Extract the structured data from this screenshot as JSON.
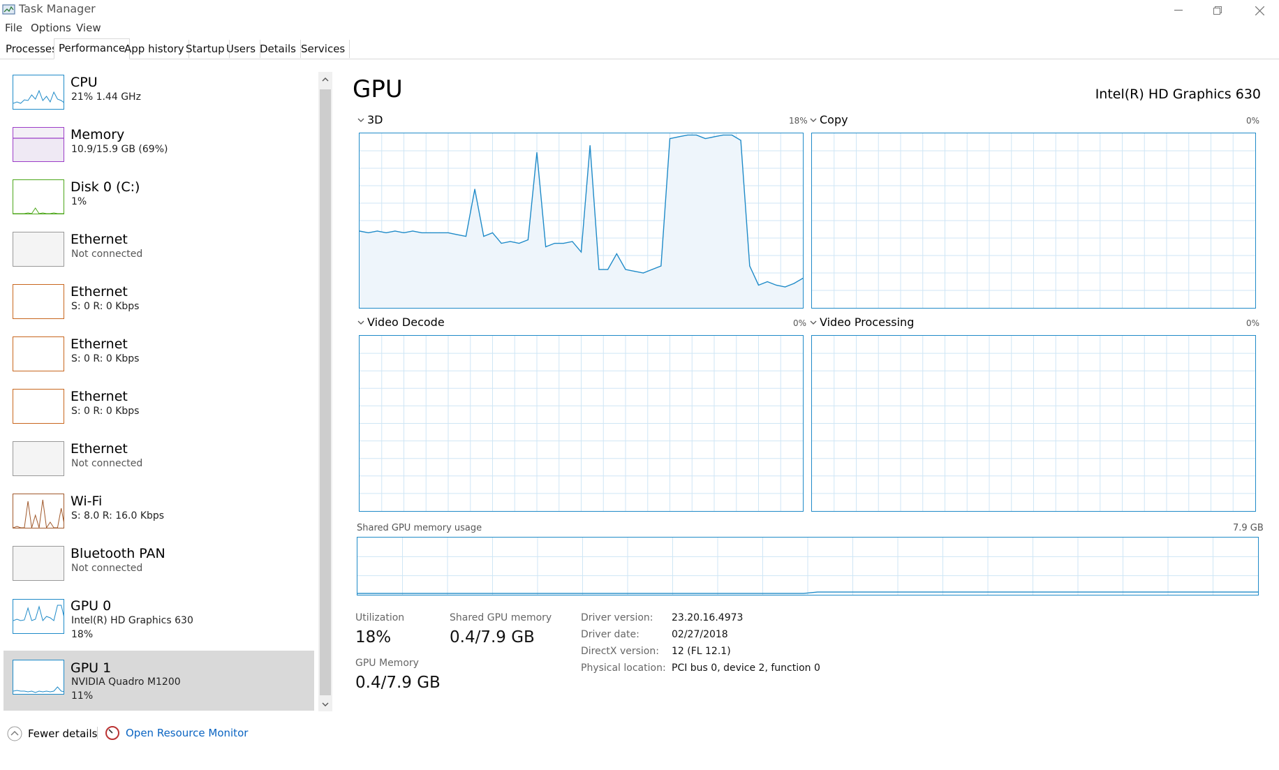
{
  "window": {
    "title": "Task Manager"
  },
  "menu": [
    "File",
    "Options",
    "View"
  ],
  "tabs": [
    "Processes",
    "Performance",
    "App history",
    "Startup",
    "Users",
    "Details",
    "Services"
  ],
  "active_tab": "Performance",
  "sidebar": {
    "items": [
      {
        "name": "CPU",
        "sub": "21%  1.44 GHz",
        "color": "#1e8ac8"
      },
      {
        "name": "Memory",
        "sub": "10.9/15.9 GB (69%)",
        "color": "#9c3dc8"
      },
      {
        "name": "Disk 0 (C:)",
        "sub": "1%",
        "color": "#4ca619"
      },
      {
        "name": "Ethernet",
        "sub": "Not connected",
        "color": "#999999"
      },
      {
        "name": "Ethernet",
        "sub": "S: 0  R: 0 Kbps",
        "color": "#c8661e"
      },
      {
        "name": "Ethernet",
        "sub": "S: 0  R: 0 Kbps",
        "color": "#c8661e"
      },
      {
        "name": "Ethernet",
        "sub": "S: 0  R: 0 Kbps",
        "color": "#c8661e"
      },
      {
        "name": "Ethernet",
        "sub": "Not connected",
        "color": "#999999"
      },
      {
        "name": "Wi-Fi",
        "sub": "S: 8.0  R: 16.0 Kbps",
        "color": "#a0582a"
      },
      {
        "name": "Bluetooth PAN",
        "sub": "Not connected",
        "color": "#999999"
      },
      {
        "name": "GPU 0",
        "sub": "Intel(R) HD Graphics 630",
        "sub2": "18%",
        "color": "#1e8ac8"
      },
      {
        "name": "GPU 1",
        "sub": "NVIDIA Quadro M1200",
        "sub2": "11%",
        "color": "#1e8ac8"
      }
    ],
    "selected": "GPU 0"
  },
  "main": {
    "title": "GPU",
    "model": "Intel(R) HD Graphics 630",
    "graphs": [
      {
        "label": "3D",
        "pct": "18%"
      },
      {
        "label": "Copy",
        "pct": "0%"
      },
      {
        "label": "Video Decode",
        "pct": "0%"
      },
      {
        "label": "Video Processing",
        "pct": "0%"
      }
    ],
    "shared_memory": {
      "label": "Shared GPU memory usage",
      "max": "7.9 GB"
    },
    "stats": {
      "utilization_label": "Utilization",
      "utilization": "18%",
      "shared_label": "Shared GPU memory",
      "shared": "0.4/7.9 GB",
      "gpu_mem_label": "GPU Memory",
      "gpu_mem": "0.4/7.9 GB"
    },
    "info": [
      {
        "key": "Driver version:",
        "value": "23.20.16.4973"
      },
      {
        "key": "Driver date:",
        "value": "02/27/2018"
      },
      {
        "key": "DirectX version:",
        "value": "12 (FL 12.1)"
      },
      {
        "key": "Physical location:",
        "value": "PCI bus 0, device 2, function 0"
      }
    ]
  },
  "footer": {
    "fewer": "Fewer details",
    "monitor": "Open Resource Monitor"
  },
  "colors": {
    "accent": "#1e8ac8",
    "grid": "#cfe6f5",
    "fill": "#eef5fb"
  },
  "chart_data": {
    "type": "area",
    "title": "3D",
    "ylim": [
      0,
      100
    ],
    "values": [
      44,
      43,
      44,
      43,
      44,
      43,
      44,
      43,
      43,
      43,
      43,
      42,
      41,
      68,
      41,
      43,
      37,
      38,
      37,
      39,
      89,
      35,
      37,
      37,
      38,
      32,
      93,
      22,
      22,
      31,
      22,
      21,
      20,
      22,
      24,
      97,
      98,
      99,
      99,
      97,
      98,
      99,
      99,
      96,
      24,
      13,
      15,
      13,
      12,
      14,
      17
    ]
  }
}
